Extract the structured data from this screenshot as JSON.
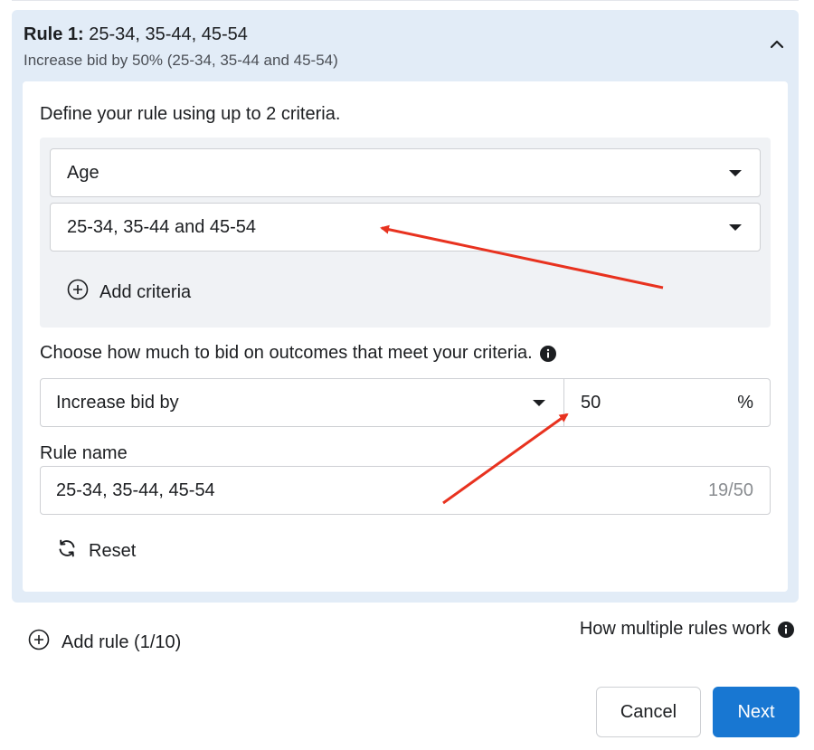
{
  "rule": {
    "title_prefix": "Rule 1:",
    "title_value": " 25-34, 35-44, 45-54",
    "subtitle": "Increase bid by 50% (25-34, 35-44 and 45-54)"
  },
  "define_label": "Define your rule using up to 2 criteria.",
  "criteria": {
    "field_value": "Age",
    "range_value": "25-34, 35-44 and 45-54",
    "add_label": "Add criteria"
  },
  "bid": {
    "label": "Choose how much to bid on outcomes that meet your criteria.",
    "mode_value": "Increase bid by",
    "amount_value": "50",
    "unit": "%"
  },
  "rule_name": {
    "label": "Rule name",
    "value": "25-34, 35-44, 45-54",
    "counter": "19/50"
  },
  "reset_label": "Reset",
  "add_rule_label": "Add rule (1/10)",
  "how_rules_label": "How multiple rules work",
  "buttons": {
    "cancel": "Cancel",
    "next": "Next"
  },
  "colors": {
    "accent": "#1877d2",
    "card_bg": "#e2ecf7",
    "annotation": "#e8321f"
  }
}
